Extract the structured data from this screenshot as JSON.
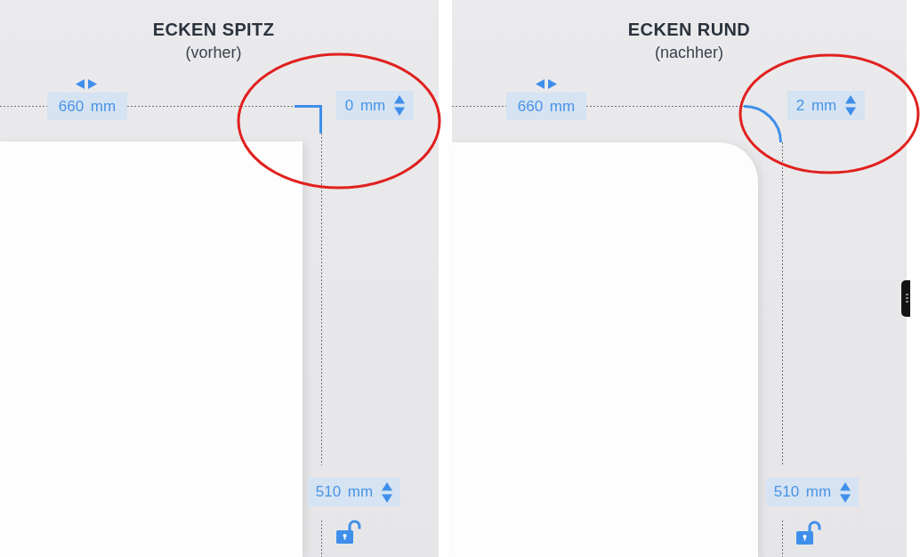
{
  "panels": [
    {
      "title": "ECKEN SPITZ",
      "subtitle": "(vorher)",
      "kind": "sharp",
      "width": "660 mm",
      "corner_radius": "0 mm",
      "height": "510 mm",
      "locked": false,
      "highlighted": true
    },
    {
      "title": "ECKEN RUND",
      "subtitle": "(nachher)",
      "kind": "round",
      "width": "660 mm",
      "corner_radius": "2 mm",
      "height": "510 mm",
      "locked": false,
      "highlighted": true
    }
  ]
}
